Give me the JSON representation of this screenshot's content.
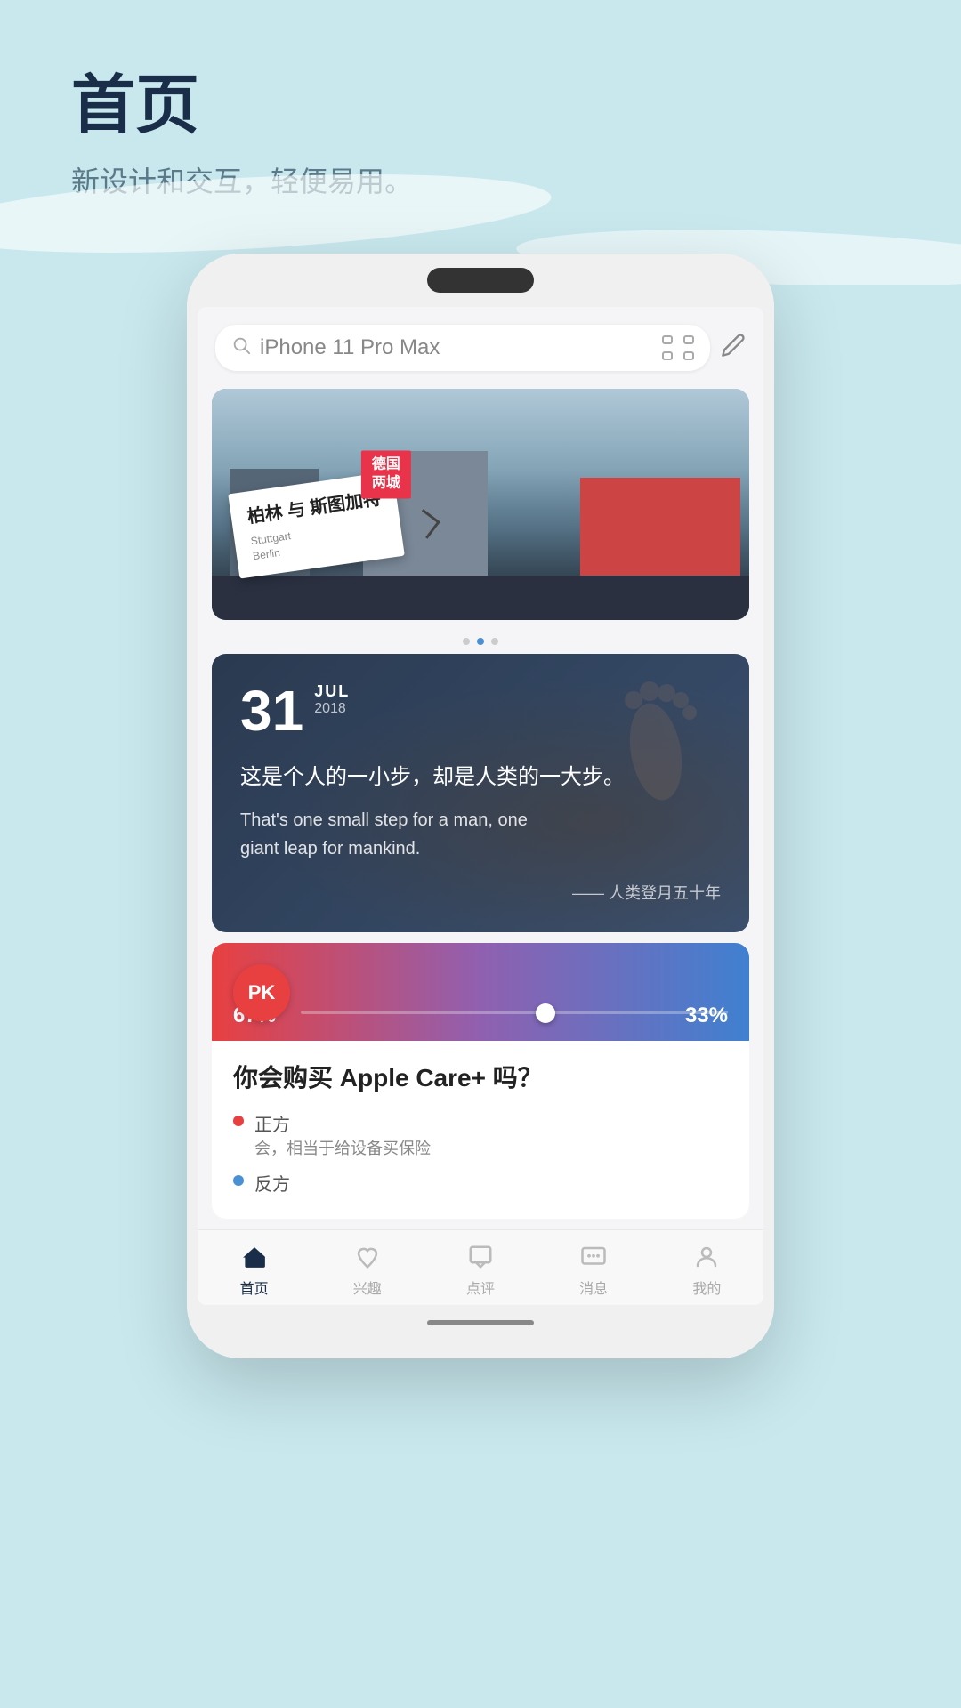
{
  "page": {
    "background_color": "#c8e8ee"
  },
  "header": {
    "title": "首页",
    "subtitle": "新设计和交互，轻便易用。"
  },
  "phone": {
    "search": {
      "placeholder": "iPhone 11 Pro Max",
      "value": "iPhone 11 Pro Max"
    },
    "banner": {
      "card_cn": "柏林\n与\n斯图加特",
      "card_red": "德国\n两城",
      "card_sub": "Stuttgart\nBerlin",
      "dots": [
        false,
        true,
        false
      ]
    },
    "date_card": {
      "day": "31",
      "month": "JUL",
      "year": "2018",
      "quote_cn": "这是个人的一小步，却是人类的一大步。",
      "quote_en": "That's one small step for a man, one\ngiant leap for mankind.",
      "author": "—— 人类登月五十年"
    },
    "pk_card": {
      "badge": "PK",
      "left_percent": "67%",
      "right_percent": "33%",
      "question": "你会购买 Apple Care+ 吗？",
      "options": [
        {
          "label": "正方",
          "text": "会，相当于给设备买保险",
          "color": "red"
        },
        {
          "label": "反方",
          "text": "",
          "color": "blue"
        }
      ]
    },
    "bottom_nav": [
      {
        "id": "home",
        "label": "首页",
        "active": true
      },
      {
        "id": "interest",
        "label": "兴趣",
        "active": false
      },
      {
        "id": "review",
        "label": "点评",
        "active": false
      },
      {
        "id": "message",
        "label": "消息",
        "active": false
      },
      {
        "id": "profile",
        "label": "我的",
        "active": false
      }
    ]
  }
}
